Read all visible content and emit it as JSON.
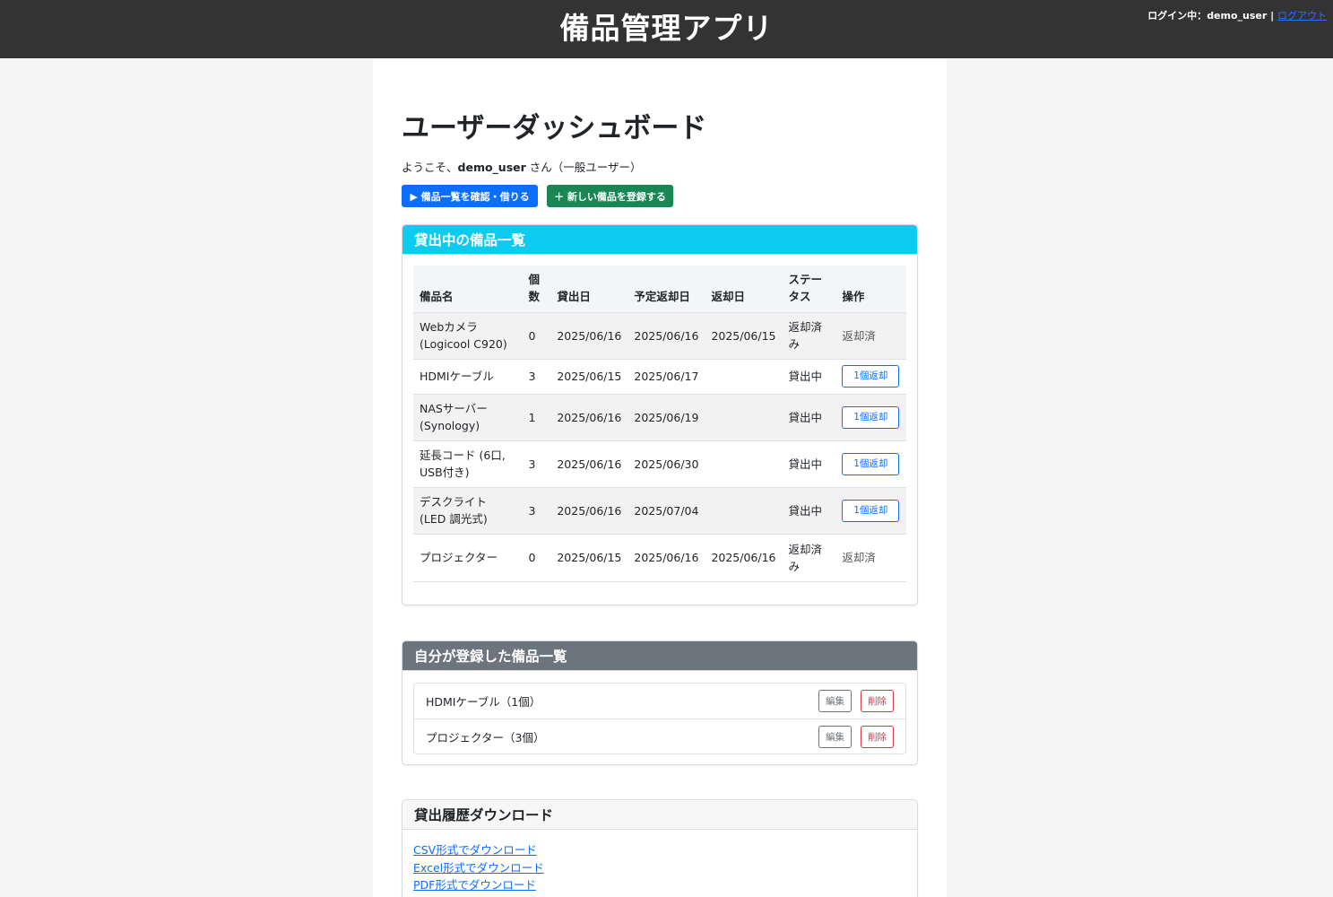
{
  "header": {
    "app_title": "備品管理アプリ",
    "login_prefix": "ログイン中：",
    "username": "demo_user",
    "separator": " | ",
    "logout_label": "ログアウト"
  },
  "page": {
    "title": "ユーザーダッシュボード",
    "welcome_prefix": "ようこそ、",
    "welcome_user": "demo_user",
    "welcome_suffix": " さん（一般ユーザー）",
    "browse_button": "▶ 備品一覧を確認・借りる",
    "register_button": "＋ 新しい備品を登録する"
  },
  "loans": {
    "title": "貸出中の備品一覧",
    "columns": [
      "備品名",
      "個数",
      "貸出日",
      "予定返却日",
      "返却日",
      "ステータス",
      "操作"
    ],
    "rows": [
      {
        "name": "Webカメラ (Logicool C920)",
        "qty": "0",
        "lent": "2025/06/16",
        "due": "2025/06/16",
        "returned": "2025/06/15",
        "status": "返却済み",
        "action": "返却済"
      },
      {
        "name": "HDMIケーブル",
        "qty": "3",
        "lent": "2025/06/15",
        "due": "2025/06/17",
        "returned": "",
        "status": "貸出中",
        "action": "1個返却"
      },
      {
        "name": "NASサーバー (Synology)",
        "qty": "1",
        "lent": "2025/06/16",
        "due": "2025/06/19",
        "returned": "",
        "status": "貸出中",
        "action": "1個返却"
      },
      {
        "name": "延長コード (6口, USB付き)",
        "qty": "3",
        "lent": "2025/06/16",
        "due": "2025/06/30",
        "returned": "",
        "status": "貸出中",
        "action": "1個返却"
      },
      {
        "name": "デスクライト (LED 調光式)",
        "qty": "3",
        "lent": "2025/06/16",
        "due": "2025/07/04",
        "returned": "",
        "status": "貸出中",
        "action": "1個返却"
      },
      {
        "name": "プロジェクター",
        "qty": "0",
        "lent": "2025/06/15",
        "due": "2025/06/16",
        "returned": "2025/06/16",
        "status": "返却済み",
        "action": "返却済"
      }
    ]
  },
  "mine": {
    "title": "自分が登録した備品一覧",
    "edit_label": "編集",
    "delete_label": "削除",
    "items": [
      {
        "label": "HDMIケーブル（1個）"
      },
      {
        "label": "プロジェクター（3個）"
      }
    ]
  },
  "download": {
    "title": "貸出履歴ダウンロード",
    "links": [
      "CSV形式でダウンロード",
      "Excel形式でダウンロード",
      "PDF形式でダウンロード"
    ]
  },
  "colors": {
    "topbar": "#333333",
    "info": "#0dcaf0",
    "primary": "#0d6efd",
    "success": "#198754",
    "secondary": "#6c757d",
    "danger": "#dc3545"
  }
}
